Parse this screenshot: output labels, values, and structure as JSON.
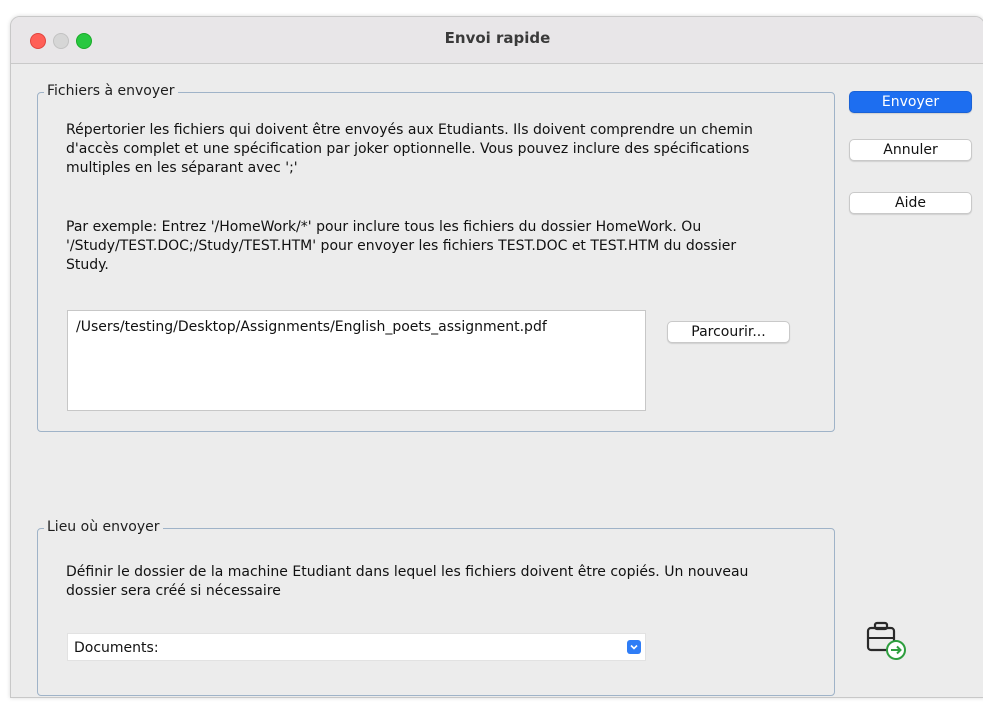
{
  "window": {
    "title": "Envoi rapide"
  },
  "files_group": {
    "label": "Fichiers à envoyer",
    "description_line1": "Répertorier les fichiers qui doivent être envoyés aux Etudiants. Ils doivent comprendre un chemin",
    "description_line2": "d'accès complet et une spécification par joker optionnelle. Vous pouvez inclure des spécifications",
    "description_line3": "multiples en les séparant avec ';'",
    "example_line1": "Par exemple: Entrez '/HomeWork/*' pour inclure tous les fichiers du dossier HomeWork. Ou",
    "example_line2": "'/Study/TEST.DOC;/Study/TEST.HTM' pour envoyer les fichiers TEST.DOC et TEST.HTM du dossier",
    "example_line3": "Study.",
    "path_value": "/Users/testing/Desktop/Assignments/English_poets_assignment.pdf",
    "browse_label": "Parcourir..."
  },
  "location_group": {
    "label": "Lieu où envoyer",
    "description_line1": "Définir le dossier de la machine Etudiant dans lequel les fichiers doivent être copiés. Un nouveau",
    "description_line2": "dossier sera créé si nécessaire",
    "selected_folder": "Documents:"
  },
  "buttons": {
    "send": "Envoyer",
    "cancel": "Annuler",
    "help": "Aide"
  },
  "icons": {
    "traffic_close": "close-window-icon",
    "traffic_minimize": "minimize-window-icon",
    "traffic_maximize": "maximize-window-icon",
    "select_arrow": "chevron-down-icon",
    "send_kit": "send-kit-icon"
  },
  "colors": {
    "accent": "#1d6ef0",
    "groupbox_border": "#9fb3c8",
    "window_bg": "#ececec"
  }
}
